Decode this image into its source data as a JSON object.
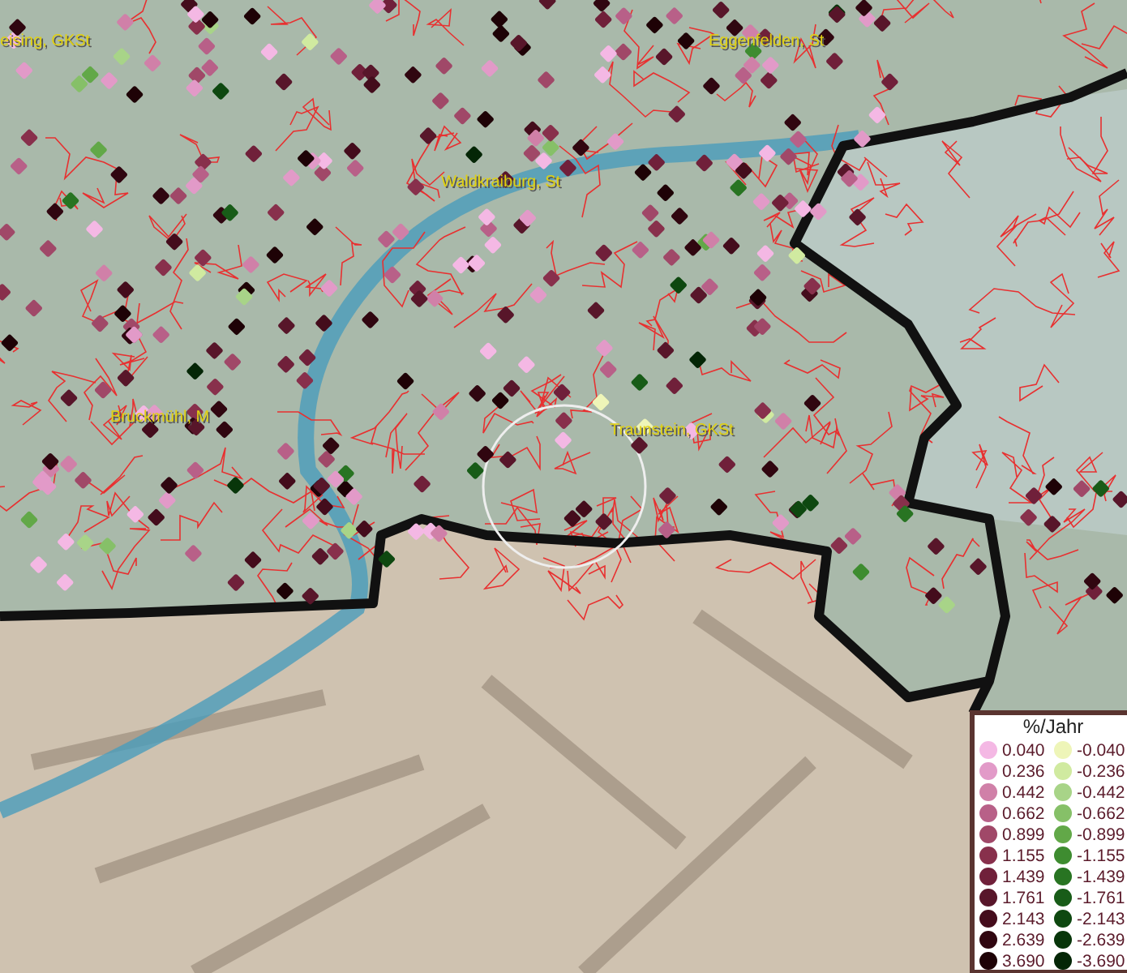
{
  "map": {
    "place_labels": [
      {
        "text": "eising, GKSt",
        "kind": "city"
      },
      {
        "text": "Eggenfelden, St",
        "kind": "city"
      },
      {
        "text": "Waldkraiburg, St",
        "kind": "city"
      },
      {
        "text": "Bruckmühl, M",
        "kind": "city"
      },
      {
        "text": "Traunstein, GKSt",
        "kind": "city"
      }
    ]
  },
  "legend": {
    "title": "%/Jahr",
    "rows": [
      {
        "positive": {
          "value": "0.040",
          "color": "#f4b8e4"
        },
        "negative": {
          "value": "-0.040",
          "color": "#eef5b8"
        }
      },
      {
        "positive": {
          "value": "0.236",
          "color": "#e29ac8"
        },
        "negative": {
          "value": "-0.236",
          "color": "#d0eaa0"
        }
      },
      {
        "positive": {
          "value": "0.442",
          "color": "#d080a8"
        },
        "negative": {
          "value": "-0.442",
          "color": "#a8d488"
        }
      },
      {
        "positive": {
          "value": "0.662",
          "color": "#b86088"
        },
        "negative": {
          "value": "-0.662",
          "color": "#86c068"
        }
      },
      {
        "positive": {
          "value": "0.899",
          "color": "#a04868"
        },
        "negative": {
          "value": "-0.899",
          "color": "#62a848"
        }
      },
      {
        "positive": {
          "value": "1.155",
          "color": "#88304c"
        },
        "negative": {
          "value": "-1.155",
          "color": "#3e8c30"
        }
      },
      {
        "positive": {
          "value": "1.439",
          "color": "#70203a"
        },
        "negative": {
          "value": "-1.439",
          "color": "#287422"
        }
      },
      {
        "positive": {
          "value": "1.761",
          "color": "#58162a"
        },
        "negative": {
          "value": "-1.761",
          "color": "#185c18"
        }
      },
      {
        "positive": {
          "value": "2.143",
          "color": "#440c1c"
        },
        "negative": {
          "value": "-2.143",
          "color": "#0e4810"
        }
      },
      {
        "positive": {
          "value": "2.639",
          "color": "#300610"
        },
        "negative": {
          "value": "-2.639",
          "color": "#08360a"
        }
      },
      {
        "positive": {
          "value": "3.690",
          "color": "#1e0206"
        },
        "negative": {
          "value": "-3.690",
          "color": "#042606"
        }
      }
    ]
  }
}
